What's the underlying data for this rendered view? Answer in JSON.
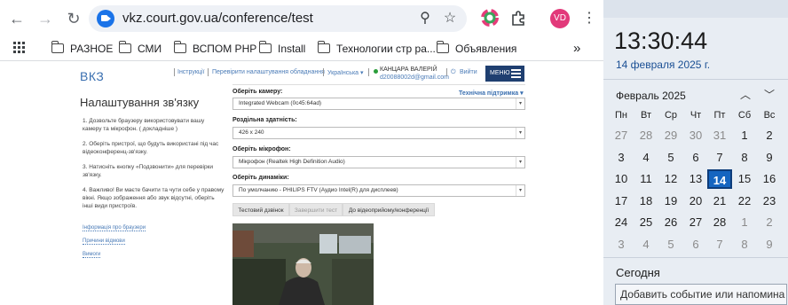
{
  "browser": {
    "url": "vkz.court.gov.ua/conference/test",
    "profile_initials": "VD",
    "bookmarks": [
      "РАЗНОЕ",
      "СМИ",
      "ВСПОМ PHP",
      "Install",
      "Технологии стр ра...",
      "Объявления"
    ],
    "more": "»"
  },
  "page": {
    "brand": "ВКЗ",
    "nav": {
      "instructions": "Інструкції",
      "check_settings": "Перевірити налаштування обладнання",
      "language": "Українська ▾",
      "user_name": "КАНЦАРА ВАЛЕРІЙ",
      "user_email": "d20088002d@gmail.com",
      "logout": "Вийти",
      "menu": "МЕНЮ"
    },
    "title": "Налаштування зв'язку",
    "steps": [
      "1. Дозвольте браузеру використовувати вашу камеру та мікрофон. ( докладніше )",
      "2. Оберіть пристрої, що будуть використані під час відеоконференц-зв'язку.",
      "3. Натисніть кнопку «Подзвонити» для перевірки зв'язку.",
      "4. Важливо! Ви маєте бачити та чути себе у правому вікні. Якщо зображення або звук відсутні, оберіть інші види пристроїв."
    ],
    "side_links": [
      "Інформація про браузери",
      "Причини відмови",
      "Вимоги"
    ],
    "support": "Технічна підтримка ▾",
    "fields": [
      {
        "label": "Оберіть камеру:",
        "value": "Integrated Webcam (0c45:64ad)"
      },
      {
        "label": "Роздільна здатність:",
        "value": "426 x 240"
      },
      {
        "label": "Оберіть мікрофон:",
        "value": "Мікрофон (Realtek High Definition Audio)"
      },
      {
        "label": "Оберіть динаміки:",
        "value": "По умолчанию - PHILIPS FTV (Аудио Intel(R) для дисплеев)"
      }
    ],
    "buttons": {
      "test_call": "Тестовий дзвінок",
      "end_test": "Завершити тест",
      "to_conference": "До відеоприйому/конференції"
    }
  },
  "calendar": {
    "time": "13:30:44",
    "date": "14 февраля 2025 г.",
    "month": "Февраль 2025",
    "weekdays": [
      "Пн",
      "Вт",
      "Ср",
      "Чт",
      "Пт",
      "Сб",
      "Вс"
    ],
    "weeks": [
      [
        "27",
        "28",
        "29",
        "30",
        "31",
        "1",
        "2"
      ],
      [
        "3",
        "4",
        "5",
        "6",
        "7",
        "8",
        "9"
      ],
      [
        "10",
        "11",
        "12",
        "13",
        "14",
        "15",
        "16"
      ],
      [
        "17",
        "18",
        "19",
        "20",
        "21",
        "22",
        "23"
      ],
      [
        "24",
        "25",
        "26",
        "27",
        "28",
        "1",
        "2"
      ],
      [
        "3",
        "4",
        "5",
        "6",
        "7",
        "8",
        "9"
      ]
    ],
    "today": "Сегодня",
    "add_event": "Добавить событие или напомина",
    "accent": "#1565c0"
  }
}
